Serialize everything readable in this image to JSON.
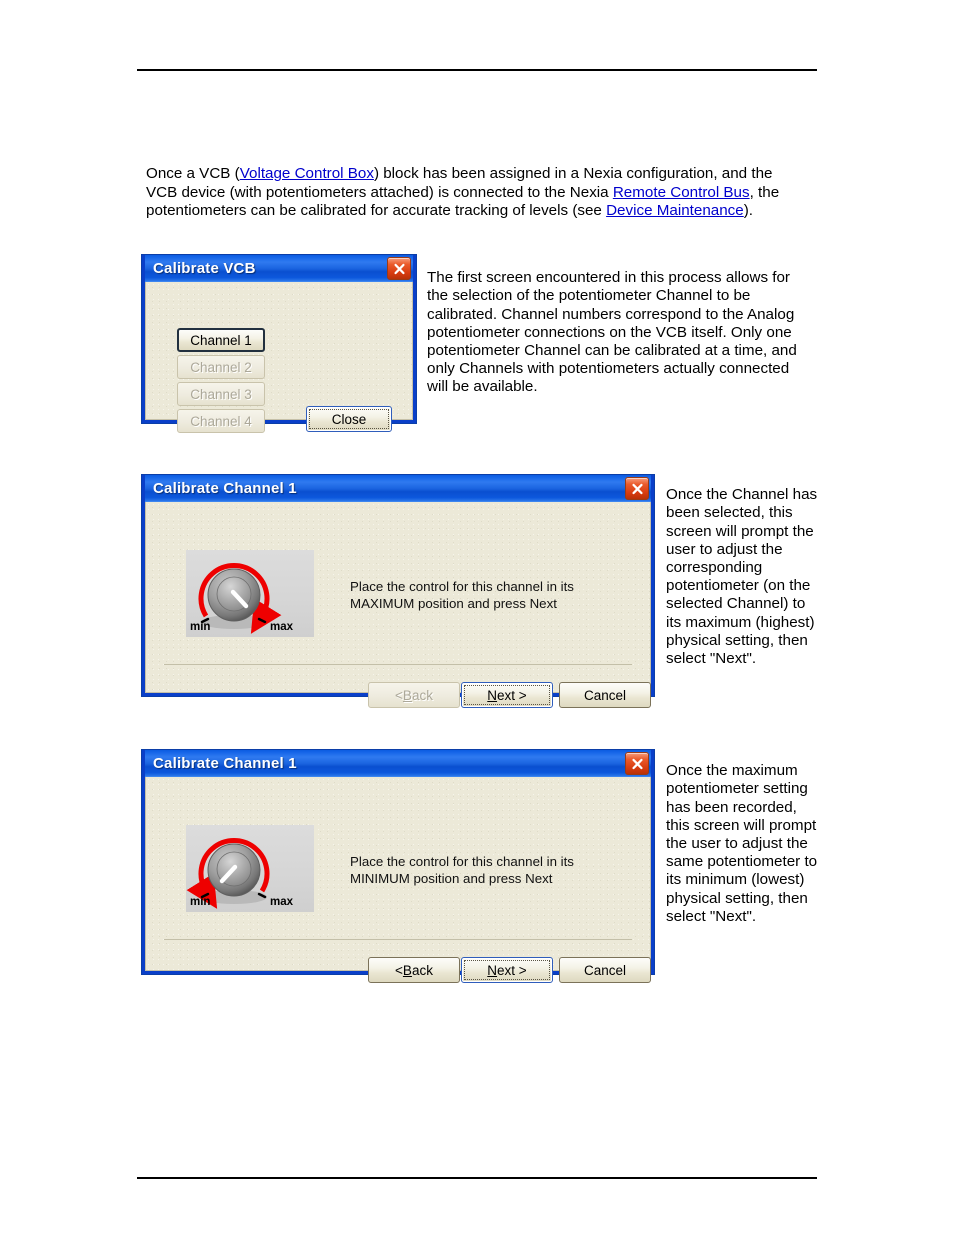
{
  "page": {
    "intro": {
      "part1": "Once a VCB (",
      "link1": "Voltage Control Box",
      "part2": ") block has been assigned in a Nexia configuration, and the VCB device (with potentiometers attached) is connected to the Nexia ",
      "link2": "Remote Control Bus",
      "part3": ", the potentiometers can be calibrated for accurate tracking of levels (see ",
      "link3": "Device Maintenance",
      "part4": ")."
    },
    "colors": {
      "titlebar_blue": "#1565e8",
      "dialog_face": "#ece9d8",
      "close_red": "#d83c10",
      "link_blue": "#0000cc",
      "knob_arrow_red": "#ee0000"
    }
  },
  "dialog_vcb": {
    "title": "Calibrate VCB",
    "close_icon": "close-icon",
    "channels": [
      {
        "label": "Channel 1",
        "enabled": true
      },
      {
        "label": "Channel 2",
        "enabled": false
      },
      {
        "label": "Channel 3",
        "enabled": false
      },
      {
        "label": "Channel 4",
        "enabled": false
      }
    ],
    "close_button": "Close"
  },
  "note_vcb": "The first screen encountered in this process allows for the selection of the potentiometer Channel to be calibrated. Channel numbers correspond to the Analog potentiometer connections on the VCB itself. Only one potentiometer Channel can be calibrated at a time, and only Channels with potentiometers actually connected will be available.",
  "dialog_max": {
    "title": "Calibrate Channel 1",
    "close_icon": "close-icon",
    "knob": {
      "min_label": "min",
      "max_label": "max",
      "pointer_position": "max",
      "arrow_direction": "clockwise"
    },
    "instruction_line1": "Place the control for this channel in its",
    "instruction_line2": "MAXIMUM position and press Next",
    "buttons": [
      {
        "label": "< Back",
        "enabled": false,
        "default": false
      },
      {
        "label": "Next >",
        "enabled": true,
        "default": true
      },
      {
        "label": "Cancel",
        "enabled": true,
        "default": false
      }
    ]
  },
  "note_max": "Once the Channel has been selected, this screen will prompt the user to adjust the corresponding potentiometer (on the selected Channel) to its maximum (highest) physical setting, then select \"Next\".",
  "dialog_min": {
    "title": "Calibrate Channel 1",
    "close_icon": "close-icon",
    "knob": {
      "min_label": "min",
      "max_label": "max",
      "pointer_position": "min",
      "arrow_direction": "counter-clockwise"
    },
    "instruction_line1": "Place the control for this channel in its",
    "instruction_line2": "MINIMUM position and press Next",
    "buttons": [
      {
        "label": "< Back",
        "enabled": true,
        "default": false
      },
      {
        "label": "Next >",
        "enabled": true,
        "default": true
      },
      {
        "label": "Cancel",
        "enabled": true,
        "default": false
      }
    ]
  },
  "note_min": "Once the maximum potentiometer setting has been recorded, this screen will prompt the user to adjust the same potentiometer to its minimum (lowest) physical setting, then select \"Next\"."
}
